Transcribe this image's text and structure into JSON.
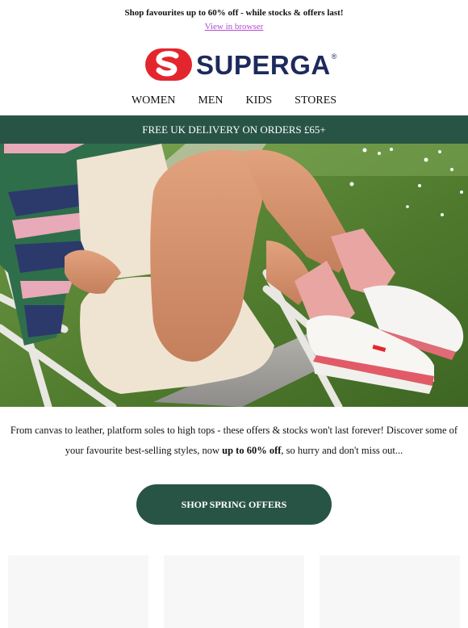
{
  "preheader": {
    "text": "Shop favourites up to 60% off - while stocks & offers last!",
    "view_link": "View in browser"
  },
  "logo": {
    "text": "SUPERGA",
    "reg_mark": "®",
    "brand_red": "#e3262e",
    "brand_navy": "#1d2a5c"
  },
  "nav": {
    "items": [
      "WOMEN",
      "MEN",
      "KIDS",
      "STORES"
    ]
  },
  "delivery_banner": {
    "text": "FREE UK DELIVERY ON ORDERS £65+",
    "bg": "#285446"
  },
  "hero": {
    "logo_on_shoe": "SUPERGA"
  },
  "intro": {
    "before": "From canvas to leather, platform soles to high tops - these offers & stocks won't last forever! Discover some of your favourite best-selling styles, now ",
    "bold": "up to 60% off",
    "after": ", so hurry and don't miss out..."
  },
  "cta": {
    "label": "SHOP SPRING OFFERS",
    "bg": "#285446"
  },
  "products": {
    "cards": [
      {},
      {},
      {}
    ]
  }
}
